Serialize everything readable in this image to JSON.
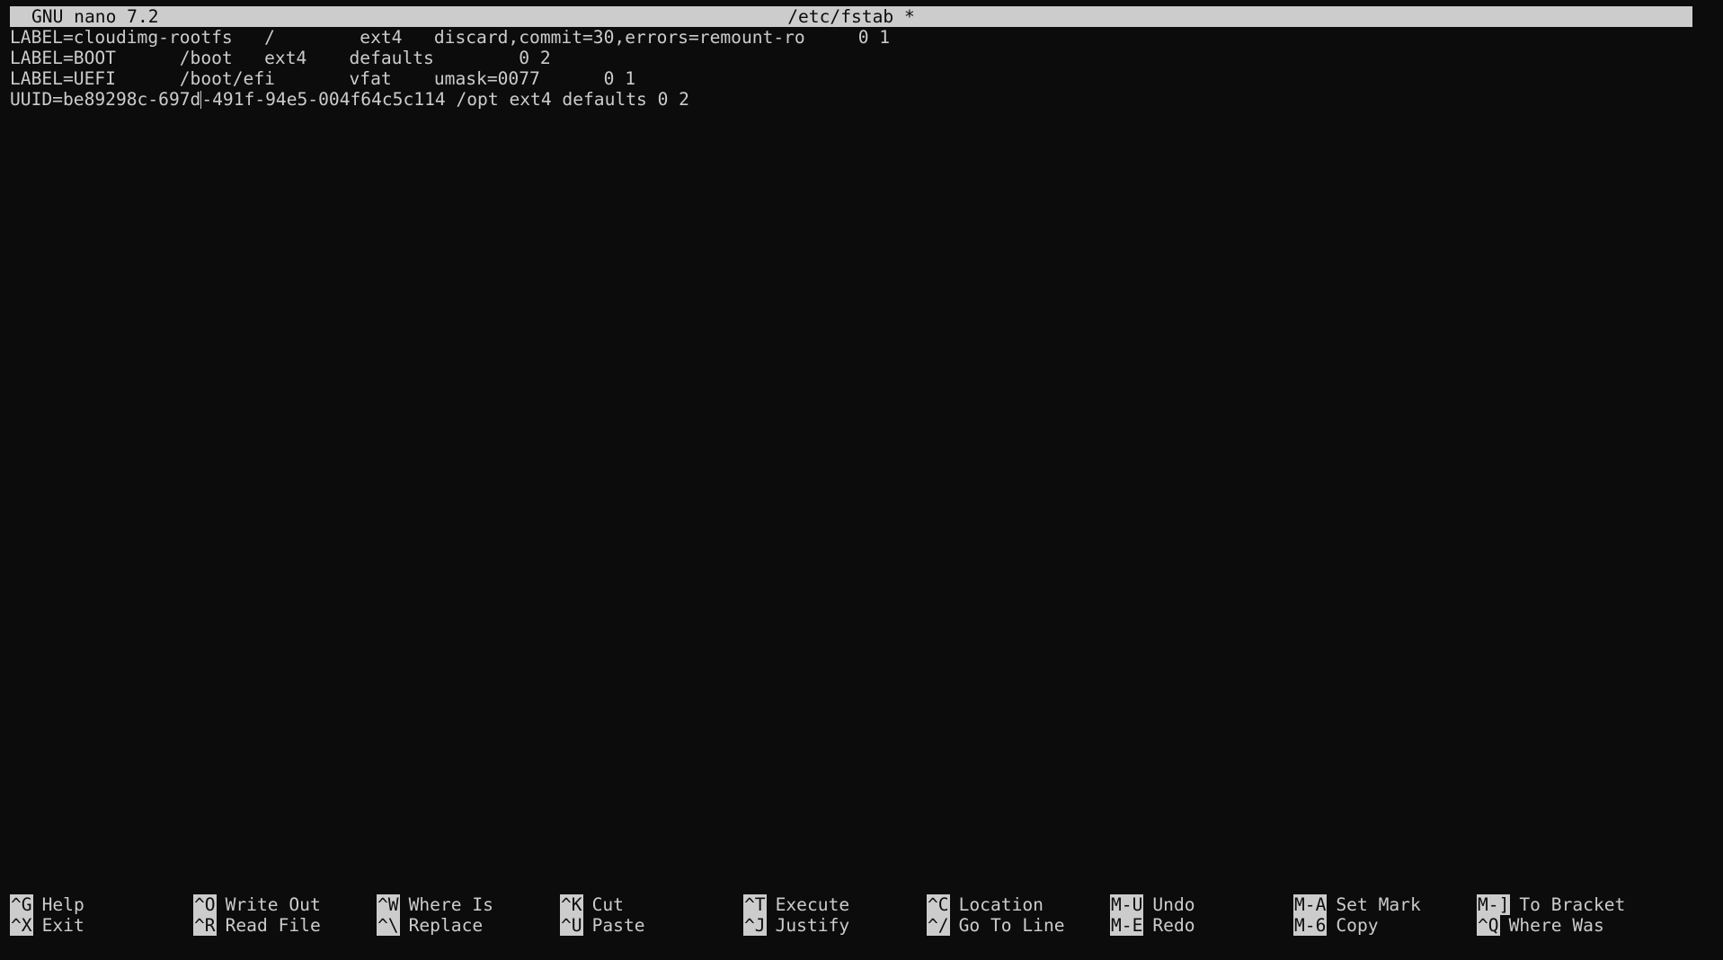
{
  "titlebar": {
    "app": "GNU nano 7.2",
    "file": "/etc/fstab *"
  },
  "editor": {
    "lines": [
      "LABEL=cloudimg-rootfs   /        ext4   discard,commit=30,errors=remount-ro     0 1",
      "LABEL=BOOT      /boot   ext4    defaults        0 2",
      "LABEL=UEFI      /boot/efi       vfat    umask=0077      0 1"
    ],
    "current_line_before": "UUID=be89298c-697d",
    "current_line_after": "-491f-94e5-004f64c5c114 /opt ext4 defaults 0 2"
  },
  "shortcuts": {
    "row1": [
      {
        "key": "^G",
        "label": "Help"
      },
      {
        "key": "^O",
        "label": "Write Out"
      },
      {
        "key": "^W",
        "label": "Where Is"
      },
      {
        "key": "^K",
        "label": "Cut"
      },
      {
        "key": "^T",
        "label": "Execute"
      },
      {
        "key": "^C",
        "label": "Location"
      },
      {
        "key": "M-U",
        "label": "Undo"
      },
      {
        "key": "M-A",
        "label": "Set Mark"
      },
      {
        "key": "M-]",
        "label": "To Bracket"
      }
    ],
    "row2": [
      {
        "key": "^X",
        "label": "Exit"
      },
      {
        "key": "^R",
        "label": "Read File"
      },
      {
        "key": "^\\",
        "label": "Replace"
      },
      {
        "key": "^U",
        "label": "Paste"
      },
      {
        "key": "^J",
        "label": "Justify"
      },
      {
        "key": "^/",
        "label": "Go To Line"
      },
      {
        "key": "M-E",
        "label": "Redo"
      },
      {
        "key": "M-6",
        "label": "Copy"
      },
      {
        "key": "^Q",
        "label": "Where Was"
      }
    ]
  }
}
